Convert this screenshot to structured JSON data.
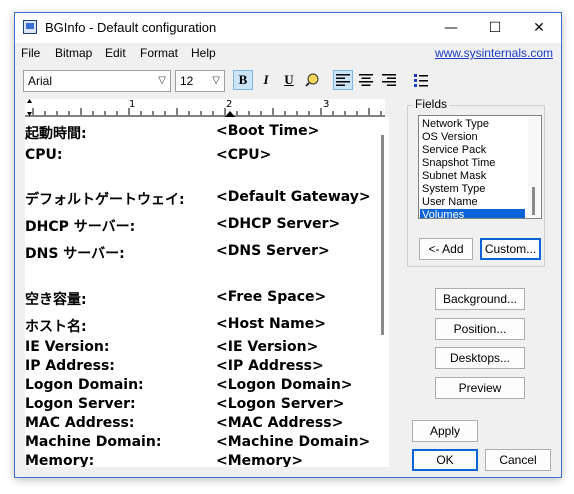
{
  "window": {
    "title": "BGInfo - Default configuration"
  },
  "controls": {
    "minimize": "—",
    "maximize": "☐",
    "close": "✕"
  },
  "menu": {
    "items": [
      "File",
      "Bitmap",
      "Edit",
      "Format",
      "Help"
    ],
    "link": "www.sysinternals.com"
  },
  "toolbar": {
    "font": "Arial",
    "size": "12",
    "bold": "B",
    "italic": "I",
    "underline": "U"
  },
  "editor": {
    "lines": [
      {
        "label": "起動時間:",
        "value": "<Boot Time>"
      },
      {
        "label": "CPU:",
        "value": "<CPU>"
      },
      {
        "label": "デフォルトゲートウェイ:",
        "value": "<Default Gateway>"
      },
      {
        "label": "DHCP サーバー:",
        "value": "<DHCP Server>"
      },
      {
        "label": "DNS サーバー:",
        "value": "<DNS Server>"
      },
      {
        "label": "空き容量:",
        "value": "<Free Space>"
      },
      {
        "label": "ホスト名:",
        "value": "<Host Name>"
      },
      {
        "label": "IE Version:",
        "value": "<IE Version>"
      },
      {
        "label": "IP Address:",
        "value": "<IP Address>"
      },
      {
        "label": "Logon Domain:",
        "value": "<Logon Domain>"
      },
      {
        "label": "Logon Server:",
        "value": "<Logon Server>"
      },
      {
        "label": "MAC Address:",
        "value": "<MAC Address>"
      },
      {
        "label": "Machine Domain:",
        "value": "<Machine Domain>"
      },
      {
        "label": "Memory:",
        "value": "<Memory>"
      }
    ]
  },
  "fields": {
    "label": "Fields",
    "items": [
      "Network Type",
      "OS Version",
      "Service Pack",
      "Snapshot Time",
      "Subnet Mask",
      "System Type",
      "User Name",
      "Volumes"
    ],
    "selected": "Volumes",
    "add": "<- Add",
    "custom": "Custom..."
  },
  "ruler": {
    "marks": [
      "1",
      "2",
      "3"
    ]
  },
  "buttons": {
    "background": "Background...",
    "position": "Position...",
    "desktops": "Desktops...",
    "preview": "Preview",
    "apply": "Apply",
    "ok": "OK",
    "cancel": "Cancel"
  },
  "colors": {
    "selection": "#0a64d8",
    "link": "#1a3cc9",
    "border": "#3a6fcf"
  }
}
